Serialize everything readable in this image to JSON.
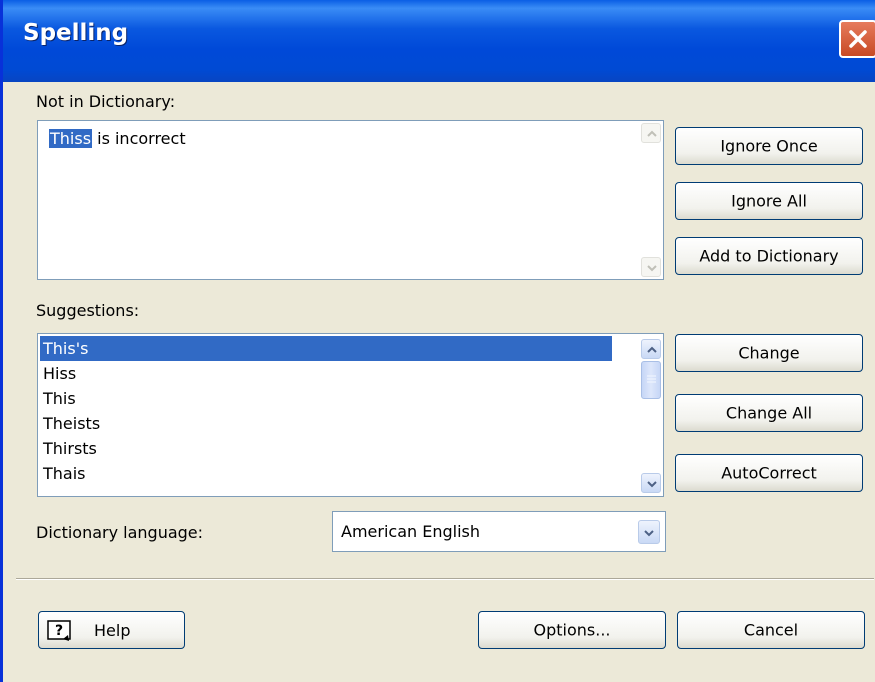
{
  "window": {
    "title": "Spelling"
  },
  "not_in_dictionary": {
    "label": "Not in Dictionary:",
    "highlighted_word": "Thiss",
    "rest_text": " is incorrect"
  },
  "suggestions": {
    "label": "Suggestions:",
    "items": [
      "This's",
      "Hiss",
      "This",
      "Theists",
      "Thirsts",
      "Thais"
    ],
    "selected_index": 0
  },
  "dictionary_language": {
    "label": "Dictionary language:",
    "value": "American English"
  },
  "buttons": {
    "ignore_once": "Ignore Once",
    "ignore_all": "Ignore All",
    "add_to_dictionary": "Add to Dictionary",
    "change": "Change",
    "change_all": "Change All",
    "autocorrect": "AutoCorrect",
    "help": "Help",
    "options": "Options...",
    "cancel": "Cancel"
  },
  "colors": {
    "selection": "#316ac5",
    "titlebar": "#0a58e0",
    "close": "#d9542f"
  }
}
